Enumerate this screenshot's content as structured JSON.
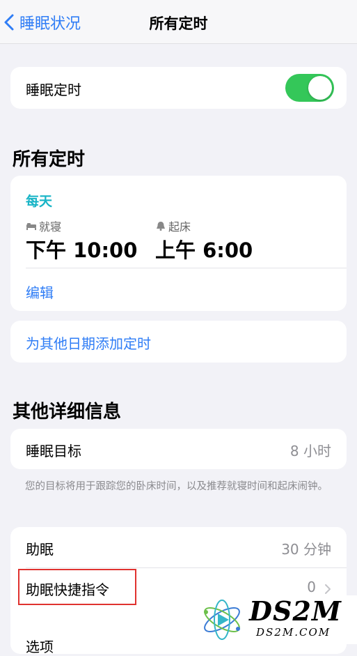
{
  "nav": {
    "back_label": "睡眠状况",
    "title": "所有定时"
  },
  "sleep_schedule": {
    "label": "睡眠定时",
    "enabled": true
  },
  "all_schedules": {
    "heading": "所有定时",
    "repeat": "每天",
    "bedtime_label": "就寝",
    "bedtime_value": "下午 10:00",
    "wake_label": "起床",
    "wake_value": "上午 6:00",
    "edit_label": "编辑",
    "add_label": "为其他日期添加定时"
  },
  "details": {
    "heading": "其他详细信息",
    "goal_label": "睡眠目标",
    "goal_value": "8 小时",
    "goal_note": "您的目标将用于跟踪您的卧床时间，以及推荐就寝时间和起床闹钟。",
    "winddown_label": "助眠",
    "winddown_value": "30 分钟",
    "shortcuts_label": "助眠快捷指令",
    "shortcuts_value": "0",
    "options_label": "选项"
  },
  "watermark": {
    "brand": "DS2M",
    "domain": "DS2M.COM"
  },
  "colors": {
    "accent": "#2f7df6",
    "teal": "#17b4c6",
    "toggle_on": "#34c759",
    "highlight": "#e0322f"
  }
}
